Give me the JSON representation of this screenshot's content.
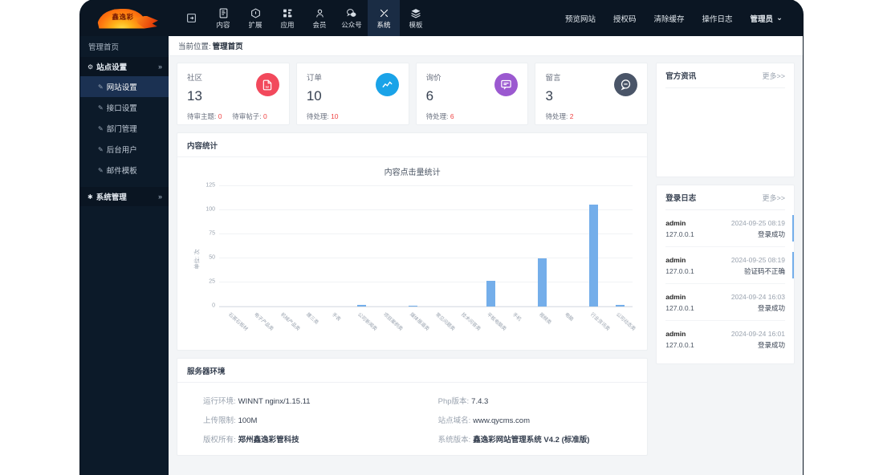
{
  "brand": {
    "logo_text": "鑫逸彩"
  },
  "topnav": {
    "collapse_icon": "collapse-icon",
    "items": [
      {
        "label": "内容",
        "icon": "content-icon",
        "active": false
      },
      {
        "label": "扩展",
        "icon": "extension-icon",
        "active": false
      },
      {
        "label": "应用",
        "icon": "apps-icon",
        "active": false
      },
      {
        "label": "会员",
        "icon": "member-icon",
        "active": false
      },
      {
        "label": "公众号",
        "icon": "wechat-icon",
        "active": false
      },
      {
        "label": "系统",
        "icon": "system-icon",
        "active": true
      },
      {
        "label": "模板",
        "icon": "template-icon",
        "active": false
      }
    ],
    "right_links": [
      "预览网站",
      "授权码",
      "清除缓存",
      "操作日志"
    ],
    "user": "管理员",
    "user_caret": "⌄"
  },
  "sidebar": {
    "header": "管理首页",
    "group": {
      "label": "站点设置",
      "icon": "gear-icon",
      "chevron": "»"
    },
    "items": [
      {
        "label": "网站设置",
        "active": true
      },
      {
        "label": "接口设置",
        "active": false
      },
      {
        "label": "部门管理",
        "active": false
      },
      {
        "label": "后台用户",
        "active": false
      },
      {
        "label": "邮件模板",
        "active": false
      }
    ],
    "group2": {
      "label": "系统管理",
      "icon": "tools-icon",
      "chevron": "»"
    }
  },
  "breadcrumb": {
    "prefix": "当前位置:",
    "current": "管理首页"
  },
  "stats": [
    {
      "title": "社区",
      "value": "13",
      "sub_label_1": "待审主题:",
      "sub_value_1": "0",
      "sub_label_2": "待审帖子:",
      "sub_value_2": "0",
      "icon": "document-word-icon",
      "color": "#f2495c"
    },
    {
      "title": "订单",
      "value": "10",
      "sub_label_1": "待处理:",
      "sub_value_1": "10",
      "sub_label_2": "",
      "sub_value_2": "",
      "icon": "chart-line-icon",
      "color": "#1aa3e8"
    },
    {
      "title": "询价",
      "value": "6",
      "sub_label_1": "待处理:",
      "sub_value_1": "6",
      "sub_label_2": "",
      "sub_value_2": "",
      "icon": "comment-icon",
      "color": "#9b59d0"
    },
    {
      "title": "留言",
      "value": "3",
      "sub_label_1": "待处理:",
      "sub_value_1": "2",
      "sub_label_2": "",
      "sub_value_2": "",
      "icon": "comment-minus-icon",
      "color": "#4a5568"
    }
  ],
  "content_panel": {
    "title": "内容统计"
  },
  "chart_data": {
    "type": "bar",
    "title": "内容点击量统计",
    "xlabel": "",
    "ylabel": "单位: 次",
    "ylim": [
      0,
      125
    ],
    "yticks": [
      0,
      25,
      50,
      75,
      100,
      125
    ],
    "grid": true,
    "legend": "none",
    "bar_color": "#74aeea",
    "categories": [
      "石英石板材",
      "电子产品类",
      "机械产品类",
      "建三类",
      "手表",
      "公司新闻类",
      "项目案例类",
      "媒体报道类",
      "常见问题类",
      "技术问答类",
      "平板电脑类",
      "手机",
      "视频类",
      "电脑",
      "行业资讯类",
      "公司动态类"
    ],
    "values": [
      0,
      0,
      0,
      0,
      0,
      2,
      0,
      1,
      0,
      0,
      27,
      0,
      50,
      0,
      106,
      2
    ]
  },
  "news_panel": {
    "title": "官方资讯",
    "more": "更多>>"
  },
  "login_panel": {
    "title": "登录日志",
    "more": "更多>>",
    "rows": [
      {
        "user": "admin",
        "ip": "127.0.0.1",
        "time": "2024-09-25 08:19",
        "status": "登录成功",
        "marked": true
      },
      {
        "user": "admin",
        "ip": "127.0.0.1",
        "time": "2024-09-25 08:19",
        "status": "验证码不正确",
        "marked": true
      },
      {
        "user": "admin",
        "ip": "127.0.0.1",
        "time": "2024-09-24 16:03",
        "status": "登录成功",
        "marked": false
      },
      {
        "user": "admin",
        "ip": "127.0.0.1",
        "time": "2024-09-24 16:01",
        "status": "登录成功",
        "marked": false
      }
    ]
  },
  "server_panel": {
    "title": "服务器环境",
    "rows": [
      {
        "left_label": "运行环境:",
        "left_value": "WINNT   nginx/1.15.11",
        "left_bold": false,
        "right_label": "Php版本:",
        "right_value": "7.4.3",
        "right_bold": false
      },
      {
        "left_label": "上传限制:",
        "left_value": "100M",
        "left_bold": false,
        "right_label": "站点域名:",
        "right_value": "www.qycms.com",
        "right_bold": false
      },
      {
        "left_label": "版权所有:",
        "left_value": "郑州鑫逸彩管科技",
        "left_bold": true,
        "right_label": "系统版本:",
        "right_value": "鑫逸彩网站管理系统 V4.2 (标准版)",
        "right_bold": true
      }
    ]
  }
}
